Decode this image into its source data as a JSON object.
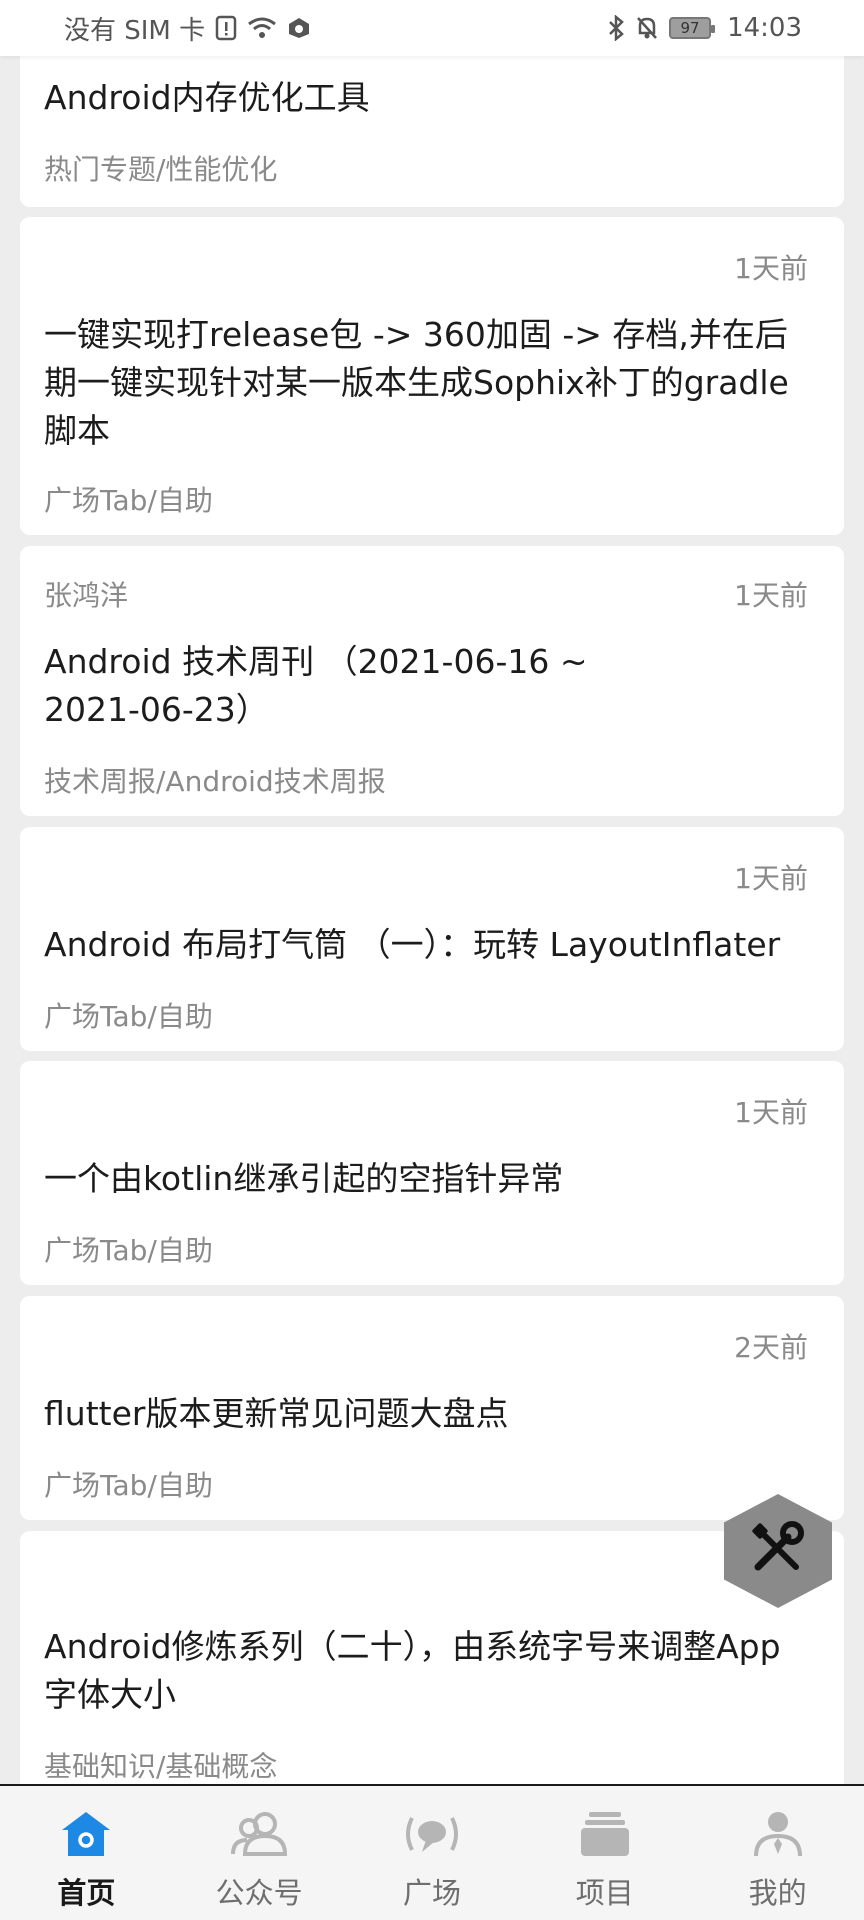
{
  "status_bar": {
    "carrier": "没有 SIM 卡",
    "battery_level": "97",
    "time": "14:03",
    "icons": [
      "sim-alert-icon",
      "wifi-icon",
      "data-icon",
      "bluetooth-icon",
      "mute-icon",
      "battery-icon"
    ]
  },
  "feed": {
    "cards": [
      {
        "author": "",
        "time": "",
        "title": "Android内存优化工具",
        "category": "热门专题/性能优化"
      },
      {
        "author": "",
        "time": "1天前",
        "title": "一键实现打release包 -> 360加固 -> 存档,并在后期一键实现针对某一版本生成Sophix补丁的gradle脚本",
        "category": "广场Tab/自助"
      },
      {
        "author": "张鸿洋",
        "time": "1天前",
        "title": "Android 技术周刊 （2021-06-16 ~ 2021-06-23）",
        "category": "技术周报/Android技术周报"
      },
      {
        "author": "",
        "time": "1天前",
        "title": "Android 布局打气筒 （一）：玩转 LayoutInflater",
        "category": "广场Tab/自助"
      },
      {
        "author": "",
        "time": "1天前",
        "title": "一个由kotlin继承引起的空指针异常",
        "category": "广场Tab/自助"
      },
      {
        "author": "",
        "time": "2天前",
        "title": "flutter版本更新常见问题大盘点",
        "category": "广场Tab/自助"
      },
      {
        "author": "",
        "time": "",
        "title": "Android修炼系列（二十），由系统字号来调整App 字体大小",
        "category": "基础知识/基础概念"
      }
    ]
  },
  "fab": {
    "icon": "tools-icon"
  },
  "bottom_nav": {
    "items": [
      {
        "label": "首页",
        "icon": "home-icon",
        "active": true
      },
      {
        "label": "公众号",
        "icon": "people-icon",
        "active": false
      },
      {
        "label": "广场",
        "icon": "broadcast-icon",
        "active": false
      },
      {
        "label": "项目",
        "icon": "folder-icon",
        "active": false
      },
      {
        "label": "我的",
        "icon": "person-icon",
        "active": false
      }
    ],
    "active_color": "#1e88e5",
    "inactive_color": "#b5b5b5"
  }
}
